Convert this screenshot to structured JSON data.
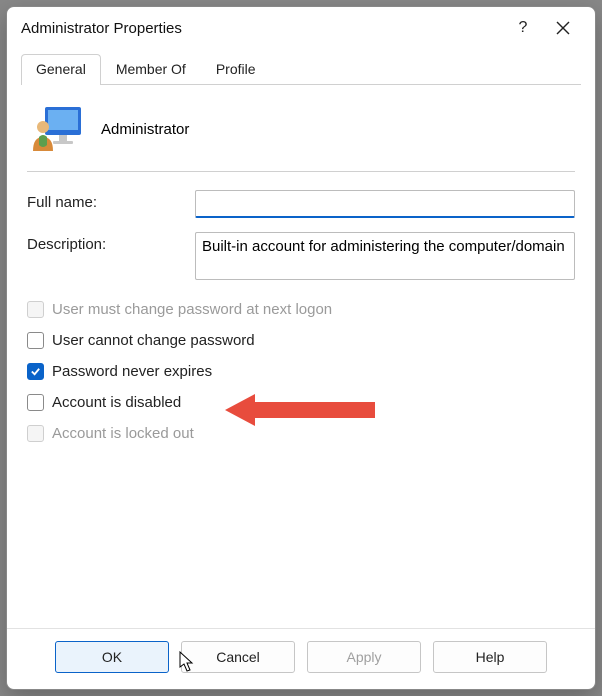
{
  "window": {
    "title": "Administrator Properties"
  },
  "tabs": [
    {
      "label": "General",
      "active": true
    },
    {
      "label": "Member Of",
      "active": false
    },
    {
      "label": "Profile",
      "active": false
    }
  ],
  "user": {
    "name": "Administrator"
  },
  "fields": {
    "fullname_label": "Full name:",
    "fullname_value": "",
    "description_label": "Description:",
    "description_value": "Built-in account for administering the computer/domain"
  },
  "checkboxes": {
    "must_change": {
      "label": "User must change password at next logon",
      "checked": false,
      "enabled": false
    },
    "cannot_change": {
      "label": "User cannot change password",
      "checked": false,
      "enabled": true
    },
    "never_expires": {
      "label": "Password never expires",
      "checked": true,
      "enabled": true
    },
    "disabled": {
      "label": "Account is disabled",
      "checked": false,
      "enabled": true
    },
    "locked_out": {
      "label": "Account is locked out",
      "checked": false,
      "enabled": false
    }
  },
  "buttons": {
    "ok": "OK",
    "cancel": "Cancel",
    "apply": "Apply",
    "help": "Help"
  },
  "annotation": {
    "arrow_color": "#e84c3d"
  }
}
